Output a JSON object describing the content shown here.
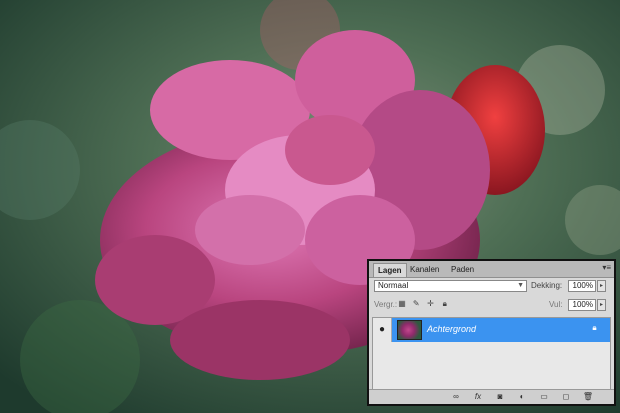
{
  "panel": {
    "tabs": [
      {
        "label": "Lagen",
        "active": true
      },
      {
        "label": "Kanalen",
        "active": false
      },
      {
        "label": "Paden",
        "active": false
      }
    ],
    "blend_mode": "Normaal",
    "opacity_label": "Dekking:",
    "opacity_value": "100%",
    "lock_label": "Vergr.:",
    "fill_label": "Vul:",
    "fill_value": "100%",
    "layers": [
      {
        "name": "Achtergrond",
        "visible": true,
        "locked": true,
        "selected": true
      }
    ],
    "footer_icons": [
      "link-icon",
      "fx-icon",
      "mask-icon",
      "adjustment-icon",
      "folder-icon",
      "new-layer-icon",
      "trash-icon"
    ],
    "accent": "#3b93f0"
  },
  "photo": {
    "subject": "pink rose",
    "colors": {
      "rose": "#c0457f",
      "bud": "#c92a2a",
      "background": "#2d4a3a"
    }
  }
}
